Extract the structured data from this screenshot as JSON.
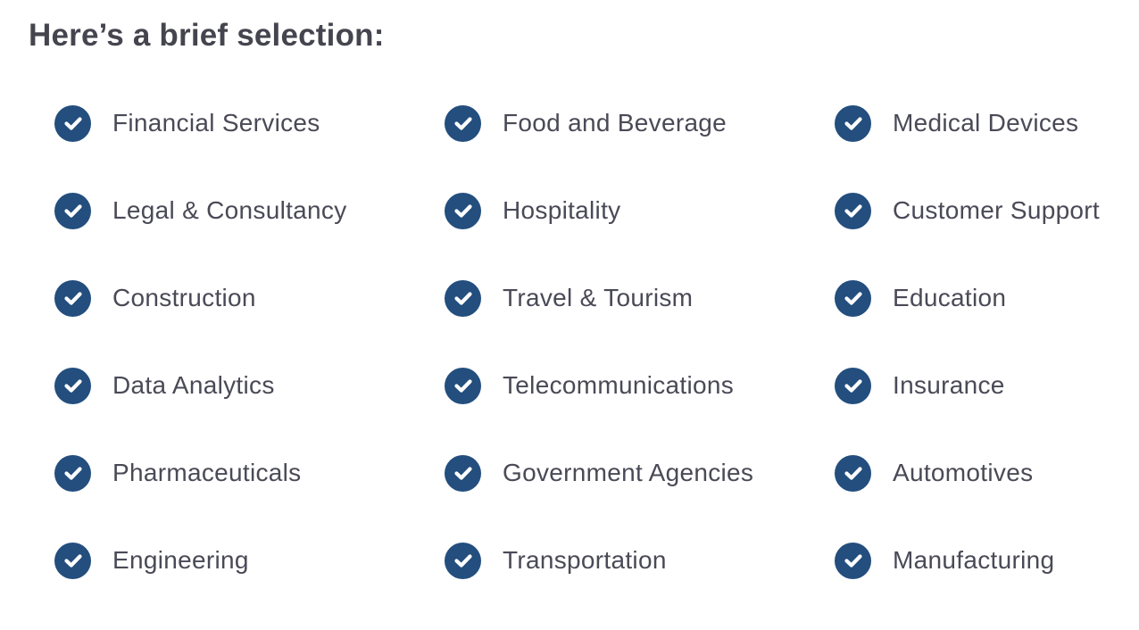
{
  "heading": "Here’s a brief selection:",
  "accent_color": "#234e7e",
  "icon": "check-circle-icon",
  "columns": [
    {
      "items": [
        "Financial Services",
        "Legal & Consultancy",
        "Construction",
        "Data Analytics",
        "Pharmaceuticals",
        "Engineering"
      ]
    },
    {
      "items": [
        "Food and Beverage",
        "Hospitality",
        "Travel & Tourism",
        "Telecommunications",
        "Government Agencies",
        "Transportation"
      ]
    },
    {
      "items": [
        "Medical Devices",
        "Customer Support",
        "Education",
        "Insurance",
        "Automotives",
        "Manufacturing"
      ]
    }
  ]
}
